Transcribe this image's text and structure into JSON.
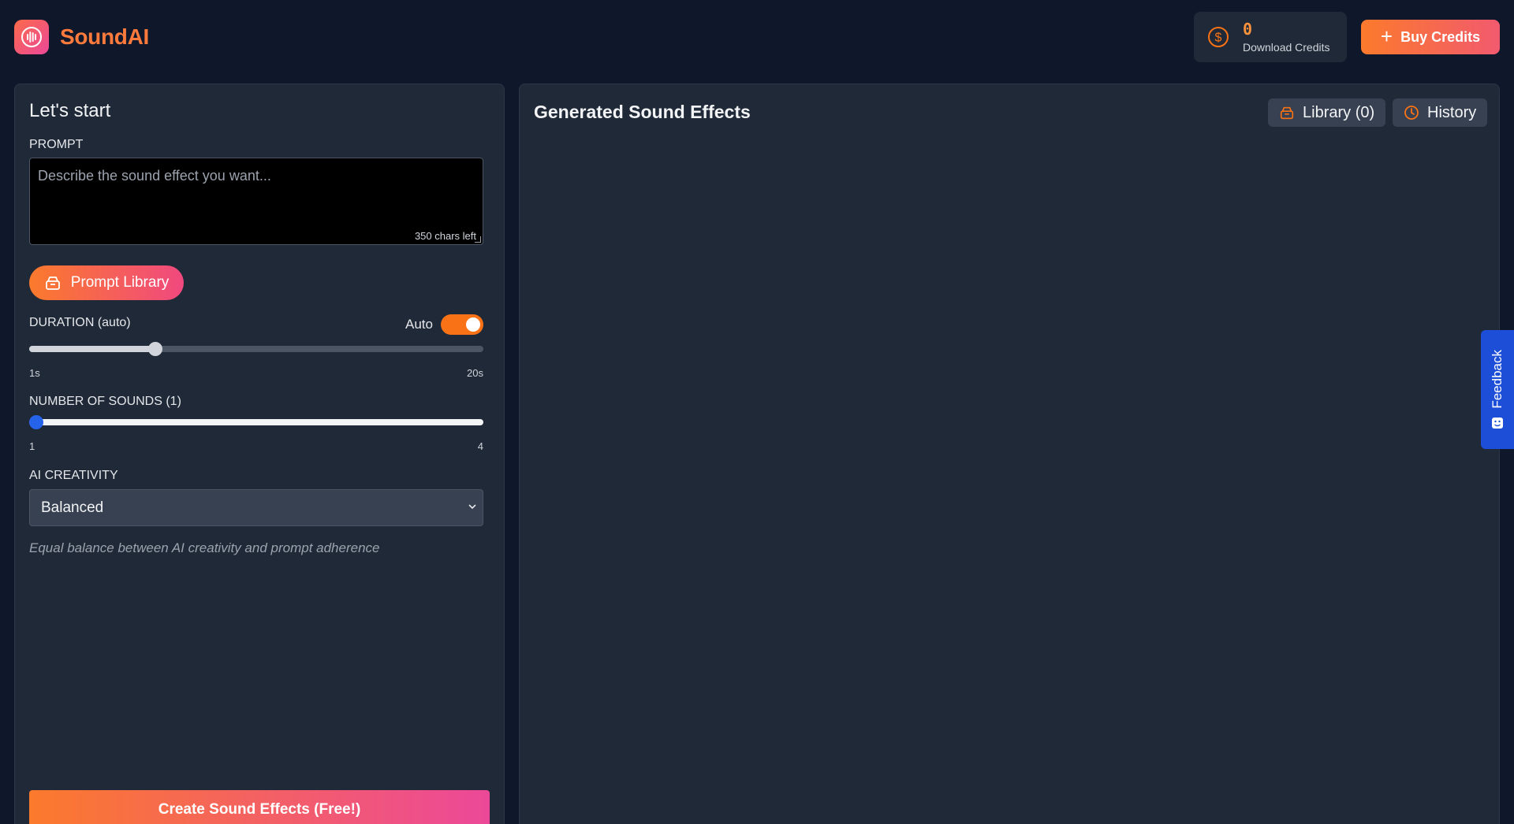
{
  "header": {
    "brand": "SoundAI",
    "credits_count": "0",
    "credits_label": "Download Credits",
    "buy_label": "Buy Credits"
  },
  "left": {
    "title": "Let's start",
    "prompt_label": "PROMPT",
    "prompt_placeholder": "Describe the sound effect you want...",
    "chars_left": "350 chars left",
    "prompt_library_label": "Prompt Library",
    "duration_label": "DURATION (auto)",
    "auto_label": "Auto",
    "auto_on": true,
    "duration_value_fraction": 0.27,
    "duration_min": "1s",
    "duration_max": "20s",
    "sounds_label": "NUMBER OF SOUNDS (1)",
    "sounds_value": 1,
    "sounds_min": "1",
    "sounds_max": "4",
    "creativity_label": "AI CREATIVITY",
    "creativity_selected": "Balanced",
    "creativity_help": "Equal balance between AI creativity and prompt adherence",
    "create_label": "Create Sound Effects (Free!)"
  },
  "right": {
    "title": "Generated Sound Effects",
    "library_label": "Library (0)",
    "history_label": "History"
  },
  "feedback": {
    "label": "Feedback"
  },
  "colors": {
    "accent": "#f97316",
    "brand": "#fb7a3c",
    "feedback": "#1d4ed8",
    "slider_blue": "#2563eb"
  }
}
